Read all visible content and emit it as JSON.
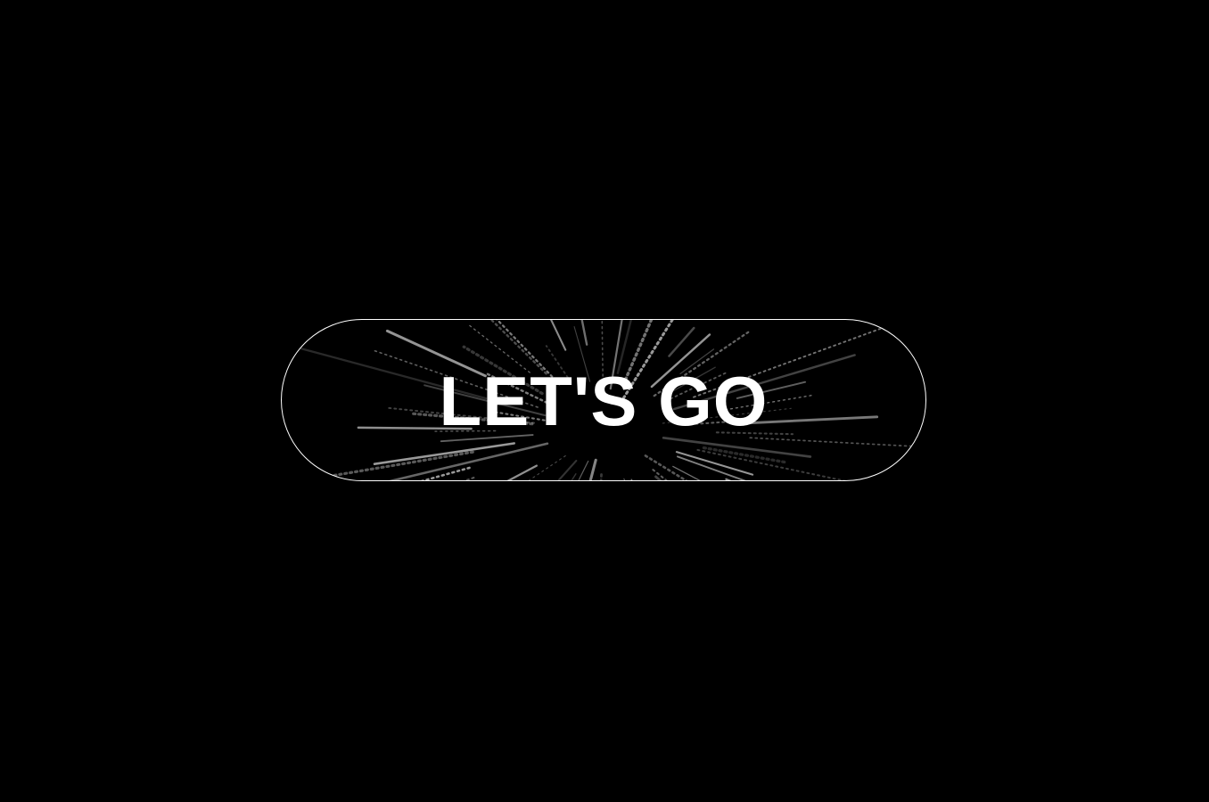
{
  "page": {
    "background_color": "#000000"
  },
  "cta": {
    "label": "LET'S GO",
    "text_color": "#ffffff",
    "border_color": "#ffffff",
    "background_effect": "starburst-speed-lines"
  }
}
